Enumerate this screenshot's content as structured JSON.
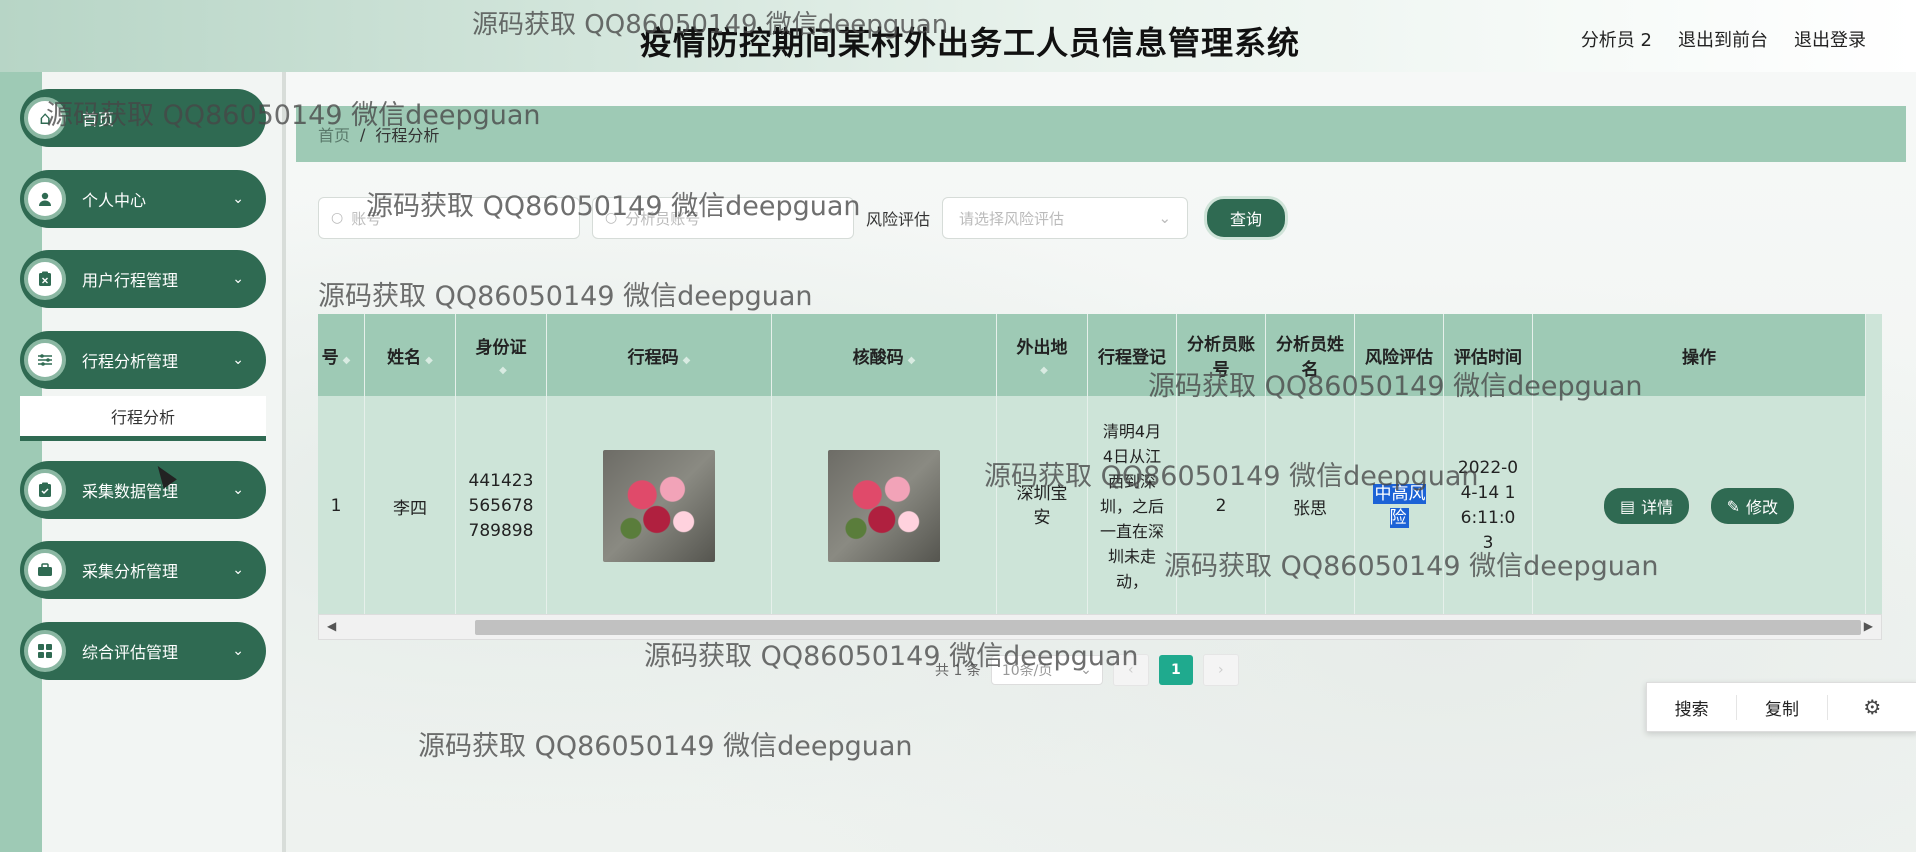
{
  "header": {
    "title": "疫情防控期间某村外出务工人员信息管理系统",
    "user": "分析员 2",
    "to_front": "退出到前台",
    "logout": "退出登录"
  },
  "sidebar": {
    "items": [
      {
        "label": "首页",
        "icon": "home-icon"
      },
      {
        "label": "个人中心",
        "icon": "user-icon"
      },
      {
        "label": "用户行程管理",
        "icon": "clipboard-icon"
      },
      {
        "label": "行程分析管理",
        "icon": "sliders-icon"
      },
      {
        "label": "采集数据管理",
        "icon": "clipboard-check-icon"
      },
      {
        "label": "采集分析管理",
        "icon": "briefcase-icon"
      },
      {
        "label": "综合评估管理",
        "icon": "grid-icon"
      }
    ],
    "submenu": "行程分析"
  },
  "breadcrumb": {
    "home": "首页",
    "sep": "/",
    "current": "行程分析"
  },
  "search": {
    "account_placeholder": "账号",
    "analyst_placeholder": "分析员账号",
    "risk_label": "风险评估",
    "risk_placeholder": "请选择风险评估",
    "query": "查询"
  },
  "table": {
    "headers": [
      "号",
      "姓名",
      "身份证",
      "行程码",
      "核酸码",
      "外出地",
      "行程登记",
      "分析员账号",
      "分析员姓名",
      "风险评估",
      "评估时间",
      "操作"
    ],
    "row": {
      "no": "1",
      "name": "李四",
      "id_card": "441423565678789898",
      "destination": "深圳宝安",
      "travel_reg": "清明4月4日从江西到深圳，之后一直在深圳未走动，",
      "analyst_account": "2",
      "analyst_name": "张思",
      "risk": "中高风险",
      "eval_time": "2022-04-14 16:11:03"
    },
    "actions": {
      "detail": "详情",
      "edit": "修改"
    }
  },
  "pager": {
    "total": "共 1 条",
    "size": "10条/页",
    "current": "1",
    "prev": "‹",
    "next": "›"
  },
  "tools": {
    "search": "搜索",
    "copy": "复制"
  },
  "watermark": "源码获取 QQ86050149 微信deepguan",
  "colors": {
    "primary": "#2f6a52",
    "header_bg": "#9ecab5",
    "row_bg": "#cde4d8",
    "page_active": "#1faa8e",
    "highlight": "#1c62d6"
  }
}
